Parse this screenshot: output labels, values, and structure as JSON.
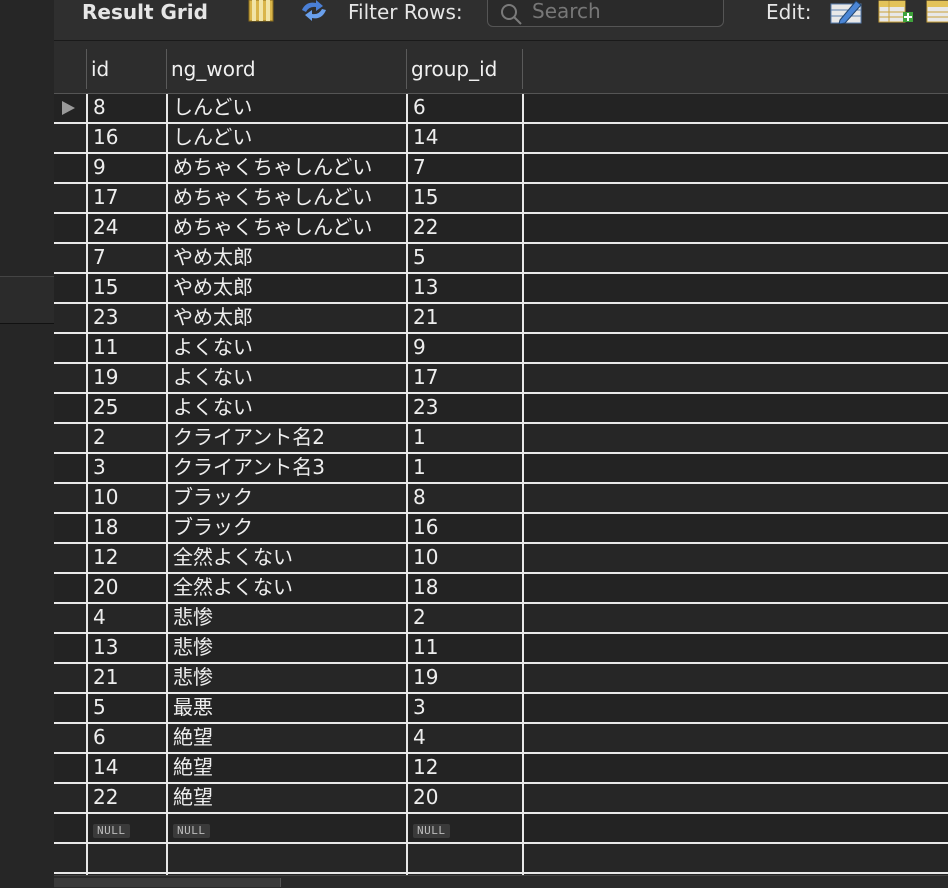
{
  "toolbar": {
    "title": "Result Grid",
    "filter_label": "Filter Rows:",
    "search_placeholder": "Search",
    "edit_label": "Edit:"
  },
  "columns": [
    "id",
    "ng_word",
    "group_id"
  ],
  "rows": [
    {
      "id": "8",
      "ng_word": "しんどい",
      "group_id": "6"
    },
    {
      "id": "16",
      "ng_word": "しんどい",
      "group_id": "14"
    },
    {
      "id": "9",
      "ng_word": "めちゃくちゃしんどい",
      "group_id": "7"
    },
    {
      "id": "17",
      "ng_word": "めちゃくちゃしんどい",
      "group_id": "15"
    },
    {
      "id": "24",
      "ng_word": "めちゃくちゃしんどい",
      "group_id": "22"
    },
    {
      "id": "7",
      "ng_word": "やめ太郎",
      "group_id": "5"
    },
    {
      "id": "15",
      "ng_word": "やめ太郎",
      "group_id": "13"
    },
    {
      "id": "23",
      "ng_word": "やめ太郎",
      "group_id": "21"
    },
    {
      "id": "11",
      "ng_word": "よくない",
      "group_id": "9"
    },
    {
      "id": "19",
      "ng_word": "よくない",
      "group_id": "17"
    },
    {
      "id": "25",
      "ng_word": "よくない",
      "group_id": "23"
    },
    {
      "id": "2",
      "ng_word": "クライアント名2",
      "group_id": "1"
    },
    {
      "id": "3",
      "ng_word": "クライアント名3",
      "group_id": "1"
    },
    {
      "id": "10",
      "ng_word": "ブラック",
      "group_id": "8"
    },
    {
      "id": "18",
      "ng_word": "ブラック",
      "group_id": "16"
    },
    {
      "id": "12",
      "ng_word": "全然よくない",
      "group_id": "10"
    },
    {
      "id": "20",
      "ng_word": "全然よくない",
      "group_id": "18"
    },
    {
      "id": "4",
      "ng_word": "悲惨",
      "group_id": "2"
    },
    {
      "id": "13",
      "ng_word": "悲惨",
      "group_id": "11"
    },
    {
      "id": "21",
      "ng_word": "悲惨",
      "group_id": "19"
    },
    {
      "id": "5",
      "ng_word": "最悪",
      "group_id": "3"
    },
    {
      "id": "6",
      "ng_word": "絶望",
      "group_id": "4"
    },
    {
      "id": "14",
      "ng_word": "絶望",
      "group_id": "12"
    },
    {
      "id": "22",
      "ng_word": "絶望",
      "group_id": "20"
    }
  ],
  "null_row": {
    "id": "NULL",
    "ng_word": "NULL",
    "group_id": "NULL"
  },
  "icons": {
    "grid_view": "column-layout-icon",
    "refresh": "refresh-icon",
    "search": "search-icon",
    "edit_row": "edit-row-icon",
    "add_row": "add-row-icon",
    "delete_row": "delete-row-icon",
    "current_row": "current-row-marker"
  }
}
